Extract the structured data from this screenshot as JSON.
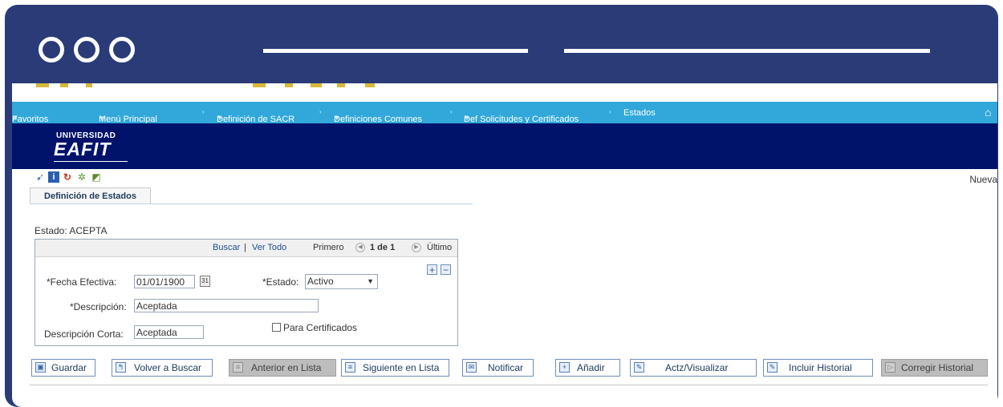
{
  "nav": {
    "favoritos": "Favoritos",
    "menu_principal": "Menú Principal",
    "crumbs": [
      "Definición de SACR",
      "Definiciones Comunes",
      "Def Solicitudes y Certificados",
      "Estados"
    ]
  },
  "banner": {
    "logo_top": "UNIVERSIDAD",
    "logo_main": "EAFIT"
  },
  "toolbar": {
    "nueva": "Nueva"
  },
  "tab": {
    "label": "Definición de Estados"
  },
  "estado": {
    "label": "Estado:",
    "value": "ACEPTA"
  },
  "grid": {
    "buscar": "Buscar",
    "sep": "|",
    "ver_todo": "Ver Todo",
    "primero": "Primero",
    "pos": "1 de 1",
    "ultimo": "Último"
  },
  "form": {
    "fecha_label": "*Fecha Efectiva:",
    "fecha_value": "01/01/1900",
    "estado_label": "*Estado:",
    "estado_value": "Activo",
    "desc_label": "*Descripción:",
    "desc_value": "Aceptada",
    "desc_corta_label": "Descripción Corta:",
    "desc_corta_value": "Aceptada",
    "para_cert_label": "Para Certificados"
  },
  "buttons": {
    "guardar": "Guardar",
    "volver": "Volver a Buscar",
    "anterior": "Anterior en Lista",
    "siguiente": "Siguiente en Lista",
    "notificar": "Notificar",
    "anadir": "Añadir",
    "actz": "Actz/Visualizar",
    "incluir": "Incluir Historial",
    "corregir": "Corregir Historial"
  },
  "colors": {
    "frame": "#2a3b78",
    "navbar": "#31a8d9",
    "banner": "#00136a"
  }
}
